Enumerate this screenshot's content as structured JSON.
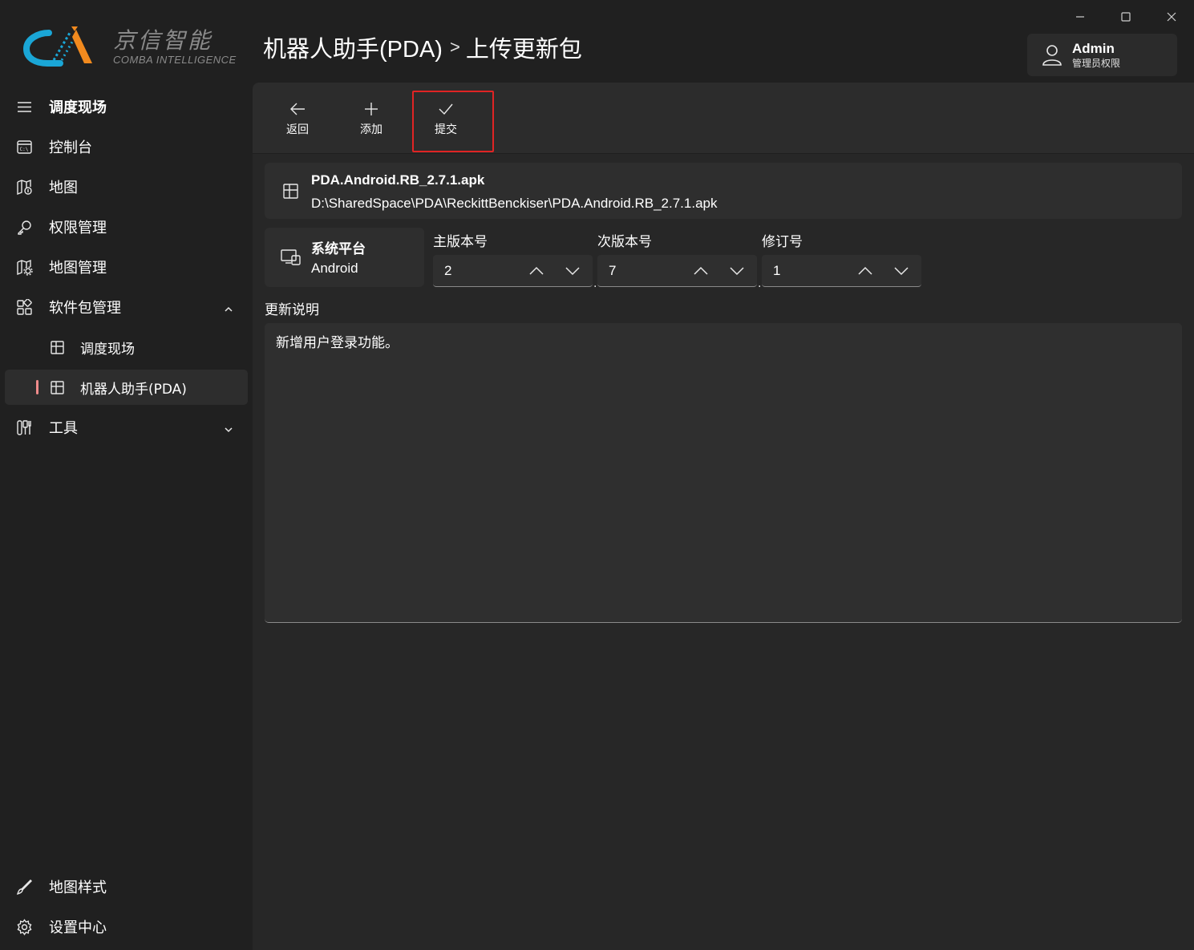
{
  "window": {
    "caption": {
      "minimize_icon": "minimize-icon",
      "maximize_icon": "maximize-icon",
      "close_icon": "close-icon"
    }
  },
  "logo": {
    "name_cn": "京信智能",
    "name_en": "COMBA INTELLIGENCE",
    "colors": {
      "teal": "#1aa6d6",
      "orange": "#f28a1e"
    }
  },
  "header": {
    "breadcrumb_parent": "机器人助手(PDA)",
    "breadcrumb_separator": ">",
    "breadcrumb_current": "上传更新包"
  },
  "user": {
    "name": "Admin",
    "role": "管理员权限",
    "icon": "user-icon"
  },
  "sidebar": {
    "items": [
      {
        "label": "调度现场",
        "icon": "hamburger-icon",
        "bold": true
      },
      {
        "label": "控制台",
        "icon": "console-icon"
      },
      {
        "label": "地图",
        "icon": "map-icon"
      },
      {
        "label": "权限管理",
        "icon": "key-icon"
      },
      {
        "label": "地图管理",
        "icon": "map-manage-icon"
      },
      {
        "label": "软件包管理",
        "icon": "apps-icon",
        "expanded": true
      },
      {
        "label": "调度现场",
        "icon": "package-icon",
        "sub": true
      },
      {
        "label": "机器人助手(PDA)",
        "icon": "package-icon",
        "sub": true,
        "active": true
      },
      {
        "label": "工具",
        "icon": "tools-icon",
        "expanded": false
      }
    ],
    "footer_items": [
      {
        "label": "地图样式",
        "icon": "brush-icon"
      },
      {
        "label": "设置中心",
        "icon": "settings-icon"
      }
    ],
    "active_indicator_color": "#f08b8b"
  },
  "toolbar": {
    "back_label": "返回",
    "add_label": "添加",
    "submit_label": "提交",
    "highlight_color": "#e02424"
  },
  "file": {
    "name": "PDA.Android.RB_2.7.1.apk",
    "path": "D:\\SharedSpace\\PDA\\ReckittBenckiser\\PDA.Android.RB_2.7.1.apk"
  },
  "platform": {
    "label": "系统平台",
    "value": "Android"
  },
  "version": {
    "major_label": "主版本号",
    "major_value": "2",
    "minor_label": "次版本号",
    "minor_value": "7",
    "revision_label": "修订号",
    "revision_value": "1",
    "separator": "."
  },
  "notes": {
    "label": "更新说明",
    "value": "新增用户登录功能。"
  }
}
